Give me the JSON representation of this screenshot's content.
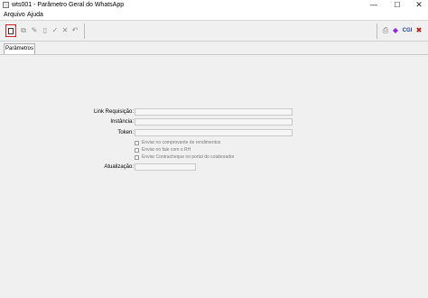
{
  "window": {
    "title": "wts001 - Parâmetro Geral do WhatsApp",
    "minimize_glyph": "—",
    "maximize_glyph": "☐",
    "close_glyph": "✕"
  },
  "menu": {
    "items": [
      {
        "label": "Arquivo"
      },
      {
        "label": "Ajuda"
      }
    ]
  },
  "toolbar": {
    "left_icons": [
      "new-document-icon",
      "copy-icon",
      "edit-icon",
      "delete-icon",
      "confirm-icon",
      "cancel-icon",
      "undo-icon"
    ],
    "right_icons": [
      "printer-icon",
      "book-icon",
      "cgi-icon",
      "close-icon"
    ],
    "cgi_label": "CGI",
    "accent_color": "#d8202a"
  },
  "tabs": [
    {
      "label": "Parâmetros",
      "active": true
    }
  ],
  "form": {
    "link_requisicao": {
      "label": "Link Requisição:",
      "value": ""
    },
    "instancia": {
      "label": "Instância:",
      "value": ""
    },
    "token": {
      "label": "Token:",
      "value": ""
    },
    "checkboxes": [
      {
        "label": "Enviar no comprovante de rendimentos",
        "checked": false
      },
      {
        "label": "Enviar no fale com o RH",
        "checked": false
      },
      {
        "label": "Enviar Contracheque no portal do colaborador",
        "checked": false
      }
    ],
    "atualizacao": {
      "label": "Atualização:",
      "value": ""
    }
  }
}
